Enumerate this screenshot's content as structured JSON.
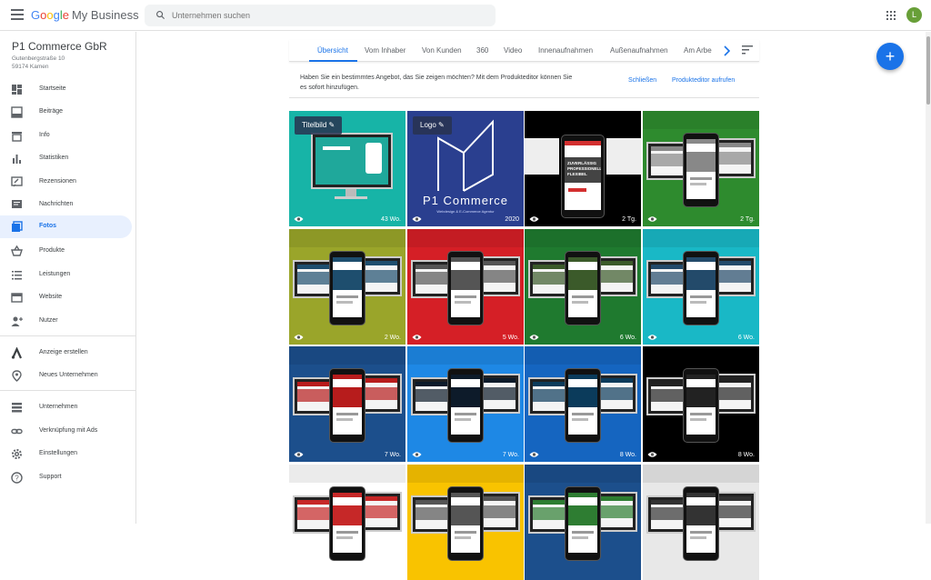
{
  "header": {
    "logo_google": [
      "G",
      "o",
      "o",
      "g",
      "l",
      "e"
    ],
    "logo_product": "My Business",
    "search_placeholder": "Unternehmen suchen",
    "avatar_initial": "L"
  },
  "business": {
    "name": "P1 Commerce GbR",
    "address_line1": "Gutenbergstraße 10",
    "address_line2": "59174 Kamen"
  },
  "sidebar": {
    "items": [
      {
        "label": "Startseite",
        "icon": "dashboard-icon"
      },
      {
        "label": "Beiträge",
        "icon": "posts-icon"
      },
      {
        "label": "Info",
        "icon": "store-icon"
      },
      {
        "label": "Statistiken",
        "icon": "bar-chart-icon"
      },
      {
        "label": "Rezensionen",
        "icon": "reviews-icon"
      },
      {
        "label": "Nachrichten",
        "icon": "message-icon"
      },
      {
        "label": "Fotos",
        "icon": "photos-icon",
        "active": true
      },
      {
        "label": "Produkte",
        "icon": "basket-icon"
      },
      {
        "label": "Leistungen",
        "icon": "list-icon"
      },
      {
        "label": "Website",
        "icon": "website-icon"
      },
      {
        "label": "Nutzer",
        "icon": "add-user-icon"
      }
    ],
    "extra_items": [
      {
        "label": "Anzeige erstellen",
        "icon": "ads-icon"
      },
      {
        "label": "Neues Unternehmen",
        "icon": "location-pin-icon"
      }
    ],
    "bottom_items": [
      {
        "label": "Unternehmen",
        "icon": "business-icon"
      },
      {
        "label": "Verknüpfung mit Ads",
        "icon": "link-icon"
      },
      {
        "label": "Einstellungen",
        "icon": "settings-icon"
      },
      {
        "label": "Support",
        "icon": "help-icon"
      }
    ]
  },
  "tabs": [
    "Übersicht",
    "Vom Inhaber",
    "Von Kunden",
    "360",
    "Video",
    "Innenaufnahmen",
    "Außenaufnahmen",
    "Am Arbe"
  ],
  "active_tab": "Übersicht",
  "promo": {
    "text": "Haben Sie ein bestimmtes Angebot, das Sie zeigen möchten? Mit dem Produkteditor können Sie es sofort hinzufügen.",
    "close_label": "Schließen",
    "open_label": "Produkteditor aufrufen"
  },
  "photos": [
    {
      "chip": "Titelbild",
      "age": "43 Wo.",
      "bg": "#17b4a7",
      "style": "monitor"
    },
    {
      "chip": "Logo",
      "age": "2020",
      "bg": "#2a3f8f",
      "style": "logo",
      "logo_text": "P1 Commerce",
      "logo_sub": "Webdesign & E-Commerce Agentur"
    },
    {
      "age": "2 Tg.",
      "bg": "#000000",
      "style": "phone",
      "accent": "#d32f2f",
      "screen_text": "ZUVERLÄSSIG PROFESSIONELL FLEXIBEL"
    },
    {
      "age": "2 Tg.",
      "bg": "#2e8b2e",
      "style": "devices",
      "accent": "#888888"
    },
    {
      "age": "2 Wo.",
      "bg": "#9aa52a",
      "style": "devices",
      "accent": "#1e4e6e"
    },
    {
      "age": "5 Wo.",
      "bg": "#d51f26",
      "style": "devices",
      "accent": "#555555"
    },
    {
      "age": "6 Wo.",
      "bg": "#1f7a2f",
      "style": "devices",
      "accent": "#3b5a2a"
    },
    {
      "age": "6 Wo.",
      "bg": "#19b8c6",
      "style": "devices",
      "accent": "#234a6a"
    },
    {
      "age": "7 Wo.",
      "bg": "#1c4f8c",
      "style": "devices",
      "accent": "#b71c1c"
    },
    {
      "age": "7 Wo.",
      "bg": "#1e88e5",
      "style": "devices",
      "accent": "#0d1b2a"
    },
    {
      "age": "8 Wo.",
      "bg": "#1565c0",
      "style": "devices",
      "accent": "#0b3b5b"
    },
    {
      "age": "8 Wo.",
      "bg": "#000000",
      "style": "devices",
      "accent": "#222222"
    },
    {
      "age": "",
      "bg": "#ffffff",
      "style": "devices",
      "accent": "#c62828"
    },
    {
      "age": "",
      "bg": "#f9c300",
      "style": "devices",
      "accent": "#555555"
    },
    {
      "age": "",
      "bg": "#1c4f8c",
      "style": "devices",
      "accent": "#2e7d32"
    },
    {
      "age": "",
      "bg": "#e8e8e8",
      "style": "devices",
      "accent": "#333333"
    }
  ],
  "colors": {
    "accent": "#1a73e8",
    "fab": "#1a73e8",
    "avatar": "#689f38"
  }
}
